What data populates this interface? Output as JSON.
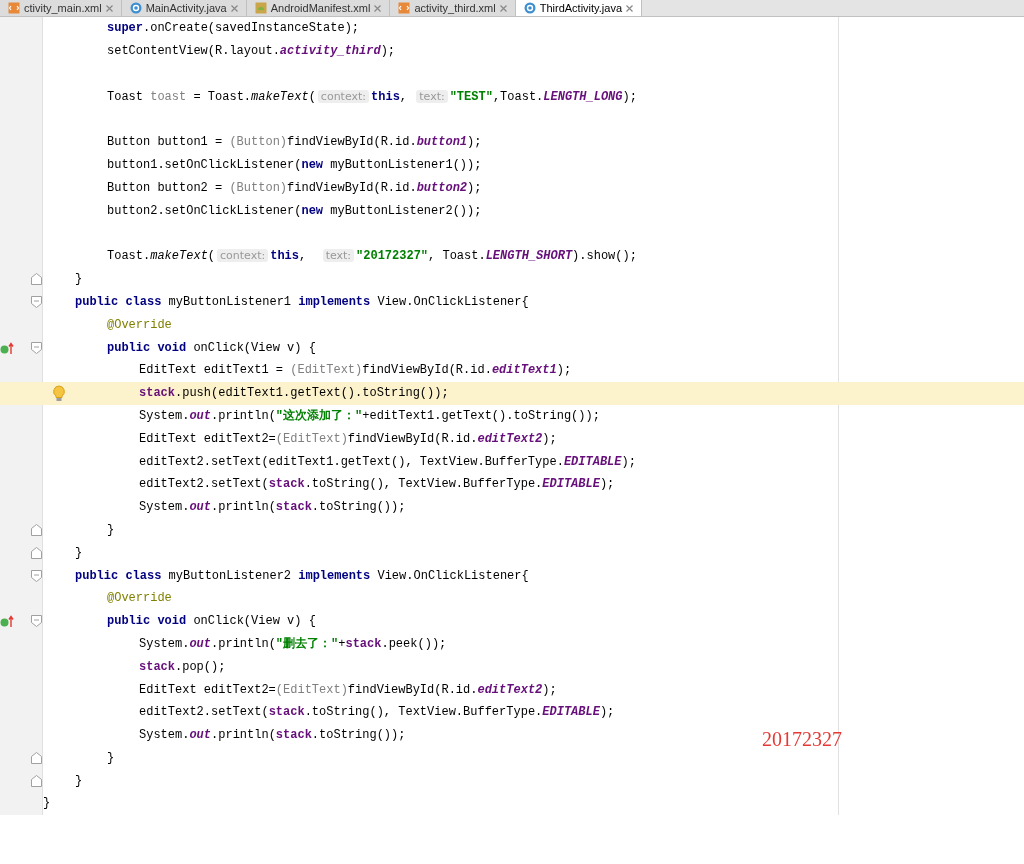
{
  "tabs": [
    {
      "label": "ctivity_main.xml",
      "kind": "layout",
      "selected": false
    },
    {
      "label": "MainActivity.java",
      "kind": "class",
      "selected": false
    },
    {
      "label": "AndroidManifest.xml",
      "kind": "manifest",
      "selected": false
    },
    {
      "label": "activity_third.xml",
      "kind": "layout",
      "selected": false
    },
    {
      "label": "ThirdActivity.java",
      "kind": "class",
      "selected": true
    }
  ],
  "lines": [
    {
      "kind": "group",
      "children": [
        {
          "kind": "group",
          "children": [
            {
              "kind": "code",
              "current": false,
              "tokens": [
                {
                  "t": "super",
                  "kind": "kw"
                },
                {
                  "t": ".onCreate(savedInstanceState);",
                  "kind": "plain"
                }
              ]
            },
            {
              "kind": "code",
              "current": false,
              "tokens": [
                {
                  "t": "setContentView(R.layout.",
                  "kind": "plain"
                },
                {
                  "t": "activity_third",
                  "kind": "static"
                },
                {
                  "t": ");",
                  "kind": "plain"
                }
              ]
            },
            {
              "kind": "blank",
              "current": false
            },
            {
              "kind": "code",
              "current": false,
              "tokens": [
                {
                  "t": "Toast ",
                  "kind": "plain"
                },
                {
                  "t": "toast",
                  "kind": "unused"
                },
                {
                  "t": " = Toast.",
                  "kind": "plain"
                },
                {
                  "t": "makeText",
                  "kind": "smethod"
                },
                {
                  "t": "(",
                  "kind": "plain"
                },
                {
                  "t": "context:",
                  "kind": "hint"
                },
                {
                  "t": "this",
                  "kind": "kw"
                },
                {
                  "t": ", ",
                  "kind": "plain"
                },
                {
                  "t": "text:",
                  "kind": "hint"
                },
                {
                  "t": "\"TEST\"",
                  "kind": "string"
                },
                {
                  "t": ",Toast.",
                  "kind": "plain"
                },
                {
                  "t": "LENGTH_LONG",
                  "kind": "static"
                },
                {
                  "t": ");",
                  "kind": "plain"
                }
              ]
            },
            {
              "kind": "blank",
              "current": false
            },
            {
              "kind": "code",
              "current": false,
              "tokens": [
                {
                  "t": "Button button1 = ",
                  "kind": "plain"
                },
                {
                  "t": "(Button)",
                  "kind": "cast"
                },
                {
                  "t": "findViewById(R.id.",
                  "kind": "plain"
                },
                {
                  "t": "button1",
                  "kind": "static"
                },
                {
                  "t": ");",
                  "kind": "plain"
                }
              ]
            },
            {
              "kind": "code",
              "current": false,
              "tokens": [
                {
                  "t": "button1.setOnClickListener(",
                  "kind": "plain"
                },
                {
                  "t": "new",
                  "kind": "kw"
                },
                {
                  "t": " myButtonListener1());",
                  "kind": "plain"
                }
              ]
            },
            {
              "kind": "code",
              "current": false,
              "tokens": [
                {
                  "t": "Button button2 = ",
                  "kind": "plain"
                },
                {
                  "t": "(Button)",
                  "kind": "cast"
                },
                {
                  "t": "findViewById(R.id.",
                  "kind": "plain"
                },
                {
                  "t": "button2",
                  "kind": "static"
                },
                {
                  "t": ");",
                  "kind": "plain"
                }
              ]
            },
            {
              "kind": "code",
              "current": false,
              "tokens": [
                {
                  "t": "button2.setOnClickListener(",
                  "kind": "plain"
                },
                {
                  "t": "new",
                  "kind": "kw"
                },
                {
                  "t": " myButtonListener2());",
                  "kind": "plain"
                }
              ]
            },
            {
              "kind": "blank",
              "current": false
            },
            {
              "kind": "code",
              "current": false,
              "tokens": [
                {
                  "t": "Toast.",
                  "kind": "plain"
                },
                {
                  "t": "makeText",
                  "kind": "smethod"
                },
                {
                  "t": "(",
                  "kind": "plain"
                },
                {
                  "t": "context:",
                  "kind": "hint"
                },
                {
                  "t": "this",
                  "kind": "kw"
                },
                {
                  "t": ",  ",
                  "kind": "plain"
                },
                {
                  "t": "text:",
                  "kind": "hint"
                },
                {
                  "t": "\"20172327\"",
                  "kind": "string"
                },
                {
                  "t": ", Toast.",
                  "kind": "plain"
                },
                {
                  "t": "LENGTH_SHORT",
                  "kind": "static"
                },
                {
                  "t": ").show();",
                  "kind": "plain"
                }
              ]
            }
          ]
        },
        {
          "kind": "code",
          "current": false,
          "fold": {
            "kind": "end"
          },
          "tokens": [
            {
              "t": "}",
              "kind": "plain"
            }
          ]
        },
        {
          "kind": "code",
          "current": false,
          "fold": {
            "kind": "start"
          },
          "tokens": [
            {
              "t": "public class",
              "kind": "kw"
            },
            {
              "t": " myButtonListener1 ",
              "kind": "plain"
            },
            {
              "t": "implements",
              "kind": "kw"
            },
            {
              "t": " View.OnClickListener{",
              "kind": "plain"
            }
          ],
          "children": [
            {
              "kind": "code",
              "current": false,
              "tokens": [
                {
                  "t": "@Override",
                  "kind": "annotation"
                }
              ]
            },
            {
              "kind": "code",
              "current": false,
              "fold": {
                "kind": "start"
              },
              "marker": {
                "kind": "override"
              },
              "tokens": [
                {
                  "t": "public void",
                  "kind": "kw"
                },
                {
                  "t": " onClick(View v) {",
                  "kind": "plain"
                }
              ],
              "children": [
                {
                  "kind": "code",
                  "current": false,
                  "tokens": [
                    {
                      "t": "EditText editText1 = ",
                      "kind": "plain"
                    },
                    {
                      "t": "(EditText)",
                      "kind": "cast"
                    },
                    {
                      "t": "findViewById(R.id.",
                      "kind": "plain"
                    },
                    {
                      "t": "editText1",
                      "kind": "static"
                    },
                    {
                      "t": ");",
                      "kind": "plain"
                    }
                  ]
                },
                {
                  "kind": "code",
                  "current": true,
                  "marker": {
                    "kind": "bulb"
                  },
                  "tokens": [
                    {
                      "t": "stack",
                      "kind": "field"
                    },
                    {
                      "t": ".push(editText1.getText().toString());",
                      "kind": "plain"
                    }
                  ]
                },
                {
                  "kind": "code",
                  "current": false,
                  "tokens": [
                    {
                      "t": "System.",
                      "kind": "plain"
                    },
                    {
                      "t": "out",
                      "kind": "static"
                    },
                    {
                      "t": ".println(",
                      "kind": "plain"
                    },
                    {
                      "t": "\"这次添加了：\"",
                      "kind": "string"
                    },
                    {
                      "t": "+editText1.getText().toString());",
                      "kind": "plain"
                    }
                  ]
                },
                {
                  "kind": "code",
                  "current": false,
                  "tokens": [
                    {
                      "t": "EditText editText2=",
                      "kind": "plain"
                    },
                    {
                      "t": "(EditText)",
                      "kind": "cast"
                    },
                    {
                      "t": "findViewById(R.id.",
                      "kind": "plain"
                    },
                    {
                      "t": "editText2",
                      "kind": "static"
                    },
                    {
                      "t": ");",
                      "kind": "plain"
                    }
                  ]
                },
                {
                  "kind": "code",
                  "current": false,
                  "tokens": [
                    {
                      "t": "editText2.setText(editText1.getText(), TextView.BufferType.",
                      "kind": "plain"
                    },
                    {
                      "t": "EDITABLE",
                      "kind": "static"
                    },
                    {
                      "t": ");",
                      "kind": "plain"
                    }
                  ]
                },
                {
                  "kind": "code",
                  "current": false,
                  "tokens": [
                    {
                      "t": "editText2.setText(",
                      "kind": "plain"
                    },
                    {
                      "t": "stack",
                      "kind": "field"
                    },
                    {
                      "t": ".toString(), TextView.BufferType.",
                      "kind": "plain"
                    },
                    {
                      "t": "EDITABLE",
                      "kind": "static"
                    },
                    {
                      "t": ");",
                      "kind": "plain"
                    }
                  ]
                },
                {
                  "kind": "code",
                  "current": false,
                  "tokens": [
                    {
                      "t": "System.",
                      "kind": "plain"
                    },
                    {
                      "t": "out",
                      "kind": "static"
                    },
                    {
                      "t": ".println(",
                      "kind": "plain"
                    },
                    {
                      "t": "stack",
                      "kind": "field"
                    },
                    {
                      "t": ".toString());",
                      "kind": "plain"
                    }
                  ]
                }
              ]
            },
            {
              "kind": "code",
              "current": false,
              "fold": {
                "kind": "end"
              },
              "tokens": [
                {
                  "t": "}",
                  "kind": "plain"
                }
              ]
            }
          ]
        },
        {
          "kind": "code",
          "current": false,
          "fold": {
            "kind": "end"
          },
          "tokens": [
            {
              "t": "}",
              "kind": "plain"
            }
          ]
        },
        {
          "kind": "code",
          "current": false,
          "fold": {
            "kind": "start"
          },
          "tokens": [
            {
              "t": "public class",
              "kind": "kw"
            },
            {
              "t": " myButtonListener2 ",
              "kind": "plain"
            },
            {
              "t": "implements",
              "kind": "kw"
            },
            {
              "t": " View.OnClickListener{",
              "kind": "plain"
            }
          ],
          "children": [
            {
              "kind": "code",
              "current": false,
              "tokens": [
                {
                  "t": "@Override",
                  "kind": "annotation"
                }
              ]
            },
            {
              "kind": "code",
              "current": false,
              "fold": {
                "kind": "start"
              },
              "marker": {
                "kind": "override"
              },
              "tokens": [
                {
                  "t": "public void",
                  "kind": "kw"
                },
                {
                  "t": " onClick(View v) {",
                  "kind": "plain"
                }
              ],
              "children": [
                {
                  "kind": "code",
                  "current": false,
                  "tokens": [
                    {
                      "t": "System.",
                      "kind": "plain"
                    },
                    {
                      "t": "out",
                      "kind": "static"
                    },
                    {
                      "t": ".println(",
                      "kind": "plain"
                    },
                    {
                      "t": "\"删去了：\"",
                      "kind": "string"
                    },
                    {
                      "t": "+",
                      "kind": "plain"
                    },
                    {
                      "t": "stack",
                      "kind": "field"
                    },
                    {
                      "t": ".peek());",
                      "kind": "plain"
                    }
                  ]
                },
                {
                  "kind": "code",
                  "current": false,
                  "tokens": [
                    {
                      "t": "stack",
                      "kind": "field"
                    },
                    {
                      "t": ".pop();",
                      "kind": "plain"
                    }
                  ]
                },
                {
                  "kind": "code",
                  "current": false,
                  "tokens": [
                    {
                      "t": "EditText editText2=",
                      "kind": "plain"
                    },
                    {
                      "t": "(EditText)",
                      "kind": "cast"
                    },
                    {
                      "t": "findViewById(R.id.",
                      "kind": "plain"
                    },
                    {
                      "t": "editText2",
                      "kind": "static"
                    },
                    {
                      "t": ");",
                      "kind": "plain"
                    }
                  ]
                },
                {
                  "kind": "code",
                  "current": false,
                  "tokens": [
                    {
                      "t": "editText2.setText(",
                      "kind": "plain"
                    },
                    {
                      "t": "stack",
                      "kind": "field"
                    },
                    {
                      "t": ".toString(), TextView.BufferType.",
                      "kind": "plain"
                    },
                    {
                      "t": "EDITABLE",
                      "kind": "static"
                    },
                    {
                      "t": ");",
                      "kind": "plain"
                    }
                  ]
                },
                {
                  "kind": "code",
                  "current": false,
                  "tokens": [
                    {
                      "t": "System.",
                      "kind": "plain"
                    },
                    {
                      "t": "out",
                      "kind": "static"
                    },
                    {
                      "t": ".println(",
                      "kind": "plain"
                    },
                    {
                      "t": "stack",
                      "kind": "field"
                    },
                    {
                      "t": ".toString());",
                      "kind": "plain"
                    }
                  ]
                }
              ]
            },
            {
              "kind": "code",
              "current": false,
              "fold": {
                "kind": "end"
              },
              "tokens": [
                {
                  "t": "}",
                  "kind": "plain"
                }
              ]
            }
          ]
        },
        {
          "kind": "code",
          "current": false,
          "fold": {
            "kind": "end"
          },
          "tokens": [
            {
              "t": "}",
              "kind": "plain"
            }
          ]
        }
      ]
    },
    {
      "kind": "code",
      "current": false,
      "tokens": [
        {
          "t": "}",
          "kind": "plain"
        }
      ]
    }
  ],
  "overlay_note": "20172327"
}
